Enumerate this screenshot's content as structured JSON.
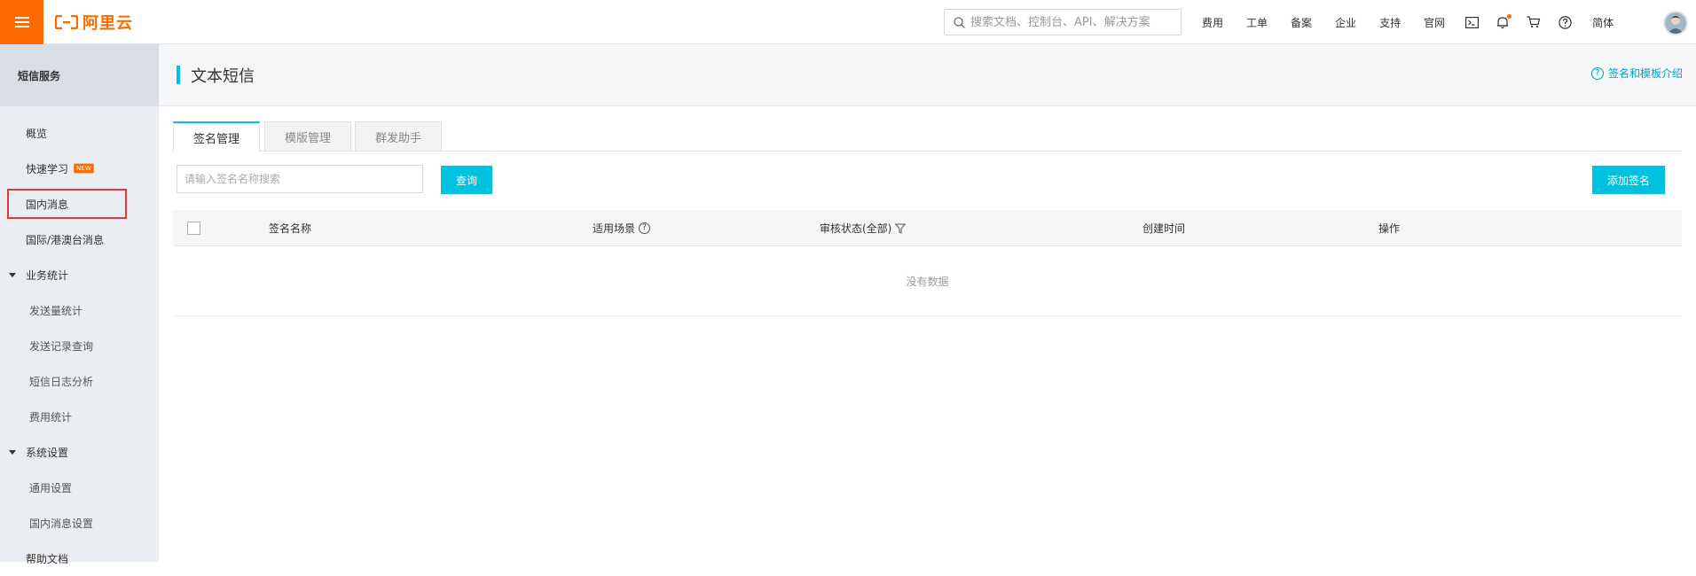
{
  "brand": {
    "logo_text": "阿里云",
    "accent_color": "#ff6a00"
  },
  "topbar": {
    "search_placeholder": "搜索文档、控制台、API、解决方案",
    "nav_items": [
      "费用",
      "工单",
      "备案",
      "企业",
      "支持",
      "官网"
    ],
    "lang": "简体",
    "icons": [
      "terminal-icon",
      "bell-icon",
      "cart-icon",
      "help-icon"
    ]
  },
  "sidebar": {
    "header": "短信服务",
    "items": [
      {
        "label": "概览"
      },
      {
        "label": "快速学习",
        "badge": "NEW"
      },
      {
        "label": "国内消息"
      },
      {
        "label": "国际/港澳台消息"
      }
    ],
    "groups": [
      {
        "label": "业务统计",
        "children": [
          "发送量统计",
          "发送记录查询",
          "短信日志分析",
          "费用统计"
        ]
      },
      {
        "label": "系统设置",
        "children": [
          "通用设置",
          "国内消息设置"
        ]
      }
    ],
    "footer_item": "帮助文档"
  },
  "page": {
    "title": "文本短信",
    "help_link": "签名和模板介绍",
    "tabs": [
      "签名管理",
      "模版管理",
      "群发助手"
    ],
    "search_placeholder": "请输入签名名称搜索",
    "query_button": "查询",
    "add_button": "添加签名",
    "columns": [
      "签名名称",
      "适用场景",
      "审核状态(全部)",
      "创建时间",
      "操作"
    ],
    "empty_text": "没有数据"
  }
}
